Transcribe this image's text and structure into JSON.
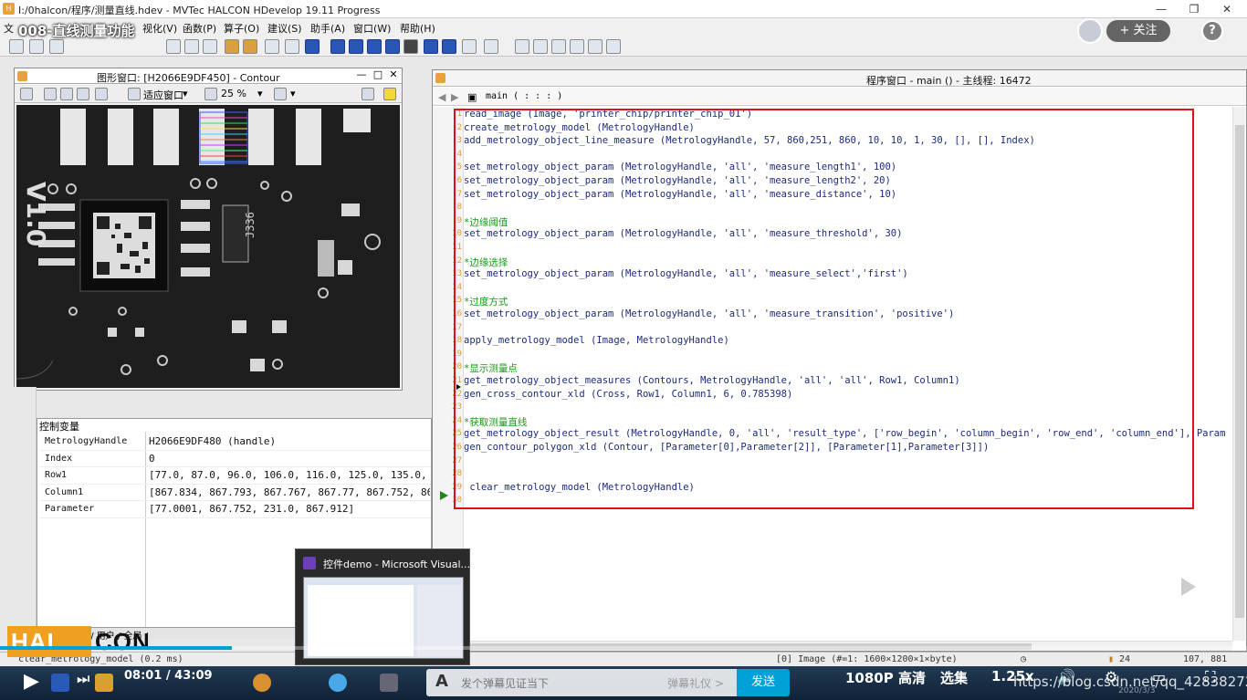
{
  "window": {
    "title": "I:/0halcon/程序/测量直线.hdev - MVTec HALCON HDevelop 19.11 Progress",
    "controls": [
      "—",
      "❐",
      "✕"
    ]
  },
  "video": {
    "title": "008-直线测量功能",
    "follow_label": "+ 关注",
    "help_label": "?"
  },
  "menu": {
    "items": [
      "文",
      "视化(V)",
      "函数(P)",
      "算子(O)",
      "建议(S)",
      "助手(A)",
      "窗口(W)",
      "帮助(H)"
    ]
  },
  "graphics_window": {
    "title": "图形窗口: [H2066E9DF450] - Contour",
    "fit_label": "适应窗口",
    "zoom_label": "25 %",
    "chip_text": "V1.0",
    "chip_code": "J336"
  },
  "variables": {
    "header": "控制变量",
    "rows": [
      {
        "name": "MetrologyHandle",
        "value": "H2066E9DF480 (handle)"
      },
      {
        "name": "Index",
        "value": "0"
      },
      {
        "name": "Row1",
        "value": "[77.0, 87.0, 96.0, 106.0, 116.0, 125.0, 135.0, 14"
      },
      {
        "name": "Column1",
        "value": "[867.834, 867.793, 867.767, 867.77, 867.752, 867."
      },
      {
        "name": "Parameter",
        "value": "[77.0001, 867.752, 231.0, 867.912]"
      }
    ],
    "bottom_tabs": "户 自 / 全 局 / 用户 / 全局 /"
  },
  "program_window": {
    "title": "程序窗口 - main () - 主线程: 16472",
    "procedure": "main ( : : : )",
    "lines": [
      {
        "n": "1",
        "text": "read_image (Image, 'printer_chip/printer_chip_01')",
        "type": "code"
      },
      {
        "n": "2",
        "text": "create_metrology_model (MetrologyHandle)",
        "type": "code"
      },
      {
        "n": "3",
        "text": "add_metrology_object_line_measure (MetrologyHandle, 57, 860,251, 860, 10, 10, 1, 30, [], [], Index)",
        "type": "code"
      },
      {
        "n": "4",
        "text": "",
        "type": "code"
      },
      {
        "n": "5",
        "text": "set_metrology_object_param (MetrologyHandle, 'all', 'measure_length1', 100)",
        "type": "code"
      },
      {
        "n": "6",
        "text": "set_metrology_object_param (MetrologyHandle, 'all', 'measure_length2', 20)",
        "type": "code"
      },
      {
        "n": "7",
        "text": "set_metrology_object_param (MetrologyHandle, 'all', 'measure_distance', 10)",
        "type": "code"
      },
      {
        "n": "8",
        "text": "",
        "type": "code"
      },
      {
        "n": "9",
        "text": "*边缘阈值",
        "type": "comment"
      },
      {
        "n": "10",
        "text": "set_metrology_object_param (MetrologyHandle, 'all', 'measure_threshold', 30)",
        "type": "code"
      },
      {
        "n": "11",
        "text": "",
        "type": "code"
      },
      {
        "n": "12",
        "text": "*边缘选择",
        "type": "comment"
      },
      {
        "n": "13",
        "text": "set_metrology_object_param (MetrologyHandle, 'all', 'measure_select','first')",
        "type": "code"
      },
      {
        "n": "14",
        "text": "",
        "type": "code"
      },
      {
        "n": "15",
        "text": "*过度方式",
        "type": "comment"
      },
      {
        "n": "16",
        "text": "set_metrology_object_param (MetrologyHandle, 'all', 'measure_transition', 'positive')",
        "type": "code"
      },
      {
        "n": "17",
        "text": "",
        "type": "code"
      },
      {
        "n": "18",
        "text": "apply_metrology_model (Image, MetrologyHandle)",
        "type": "code"
      },
      {
        "n": "19",
        "text": "",
        "type": "code"
      },
      {
        "n": "20",
        "text": "*显示测量点",
        "type": "comment"
      },
      {
        "n": "21",
        "text": "get_metrology_object_measures (Contours, MetrologyHandle, 'all', 'all', Row1, Column1)",
        "type": "code"
      },
      {
        "n": "22",
        "text": "gen_cross_contour_xld (Cross, Row1, Column1, 6, 0.785398)",
        "type": "code"
      },
      {
        "n": "23",
        "text": "",
        "type": "code"
      },
      {
        "n": "24",
        "text": "*获取测量直线",
        "type": "comment"
      },
      {
        "n": "25",
        "text": "get_metrology_object_result (MetrologyHandle, 0, 'all', 'result_type', ['row_begin', 'column_begin', 'row_end', 'column_end'], Param",
        "type": "code"
      },
      {
        "n": "26",
        "text": "gen_contour_polygon_xld (Contour, [Parameter[0],Parameter[2]], [Parameter[1],Parameter[3]])",
        "type": "code"
      },
      {
        "n": "27",
        "text": "",
        "type": "code"
      },
      {
        "n": "28",
        "text": "",
        "type": "code"
      },
      {
        "n": "29",
        "text": " clear_metrology_model (MetrologyHandle)",
        "type": "code"
      },
      {
        "n": "30",
        "text": "",
        "type": "code"
      }
    ]
  },
  "status_bar": {
    "left": "clear_metrology_model (0.2 ms)",
    "image_info": "[0] Image (#=1: 1600×1200×1×byte)",
    "value": "24",
    "coords": "107, 881"
  },
  "taskbar_thumb": {
    "title": "控件demo - Microsoft Visual..."
  },
  "halcon_logo": {
    "left": "HAL",
    "right": "CON"
  },
  "player": {
    "time": "08:01 / 43:09",
    "progress": 0.186,
    "danmaku_placeholder": "发个弹幕见证当下",
    "danmaku_etiquette": "弹幕礼仪 >",
    "send_label": "发送",
    "quality": "1080P 高清",
    "episodes": "选集",
    "speed": "1.25x",
    "watermark": "https://blog.csdn.net/qq_42838272",
    "date": "2020/3/3"
  }
}
